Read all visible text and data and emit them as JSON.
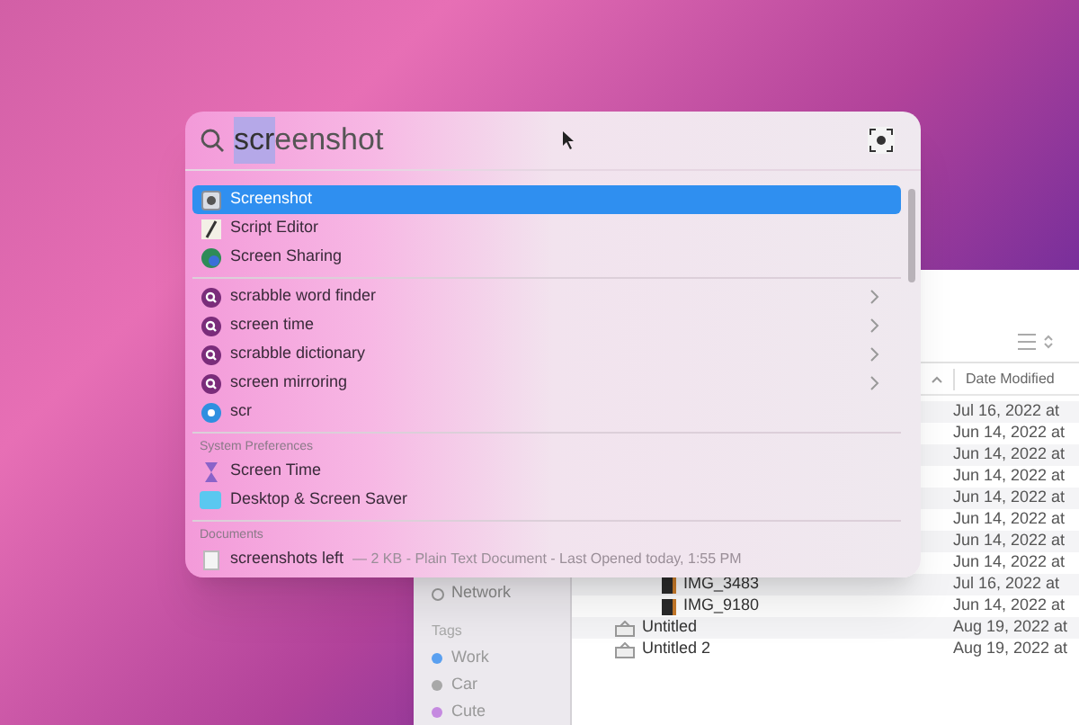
{
  "spotlight": {
    "query_typed": "scr",
    "query_completion": "eenshot",
    "sections": [
      {
        "items": [
          {
            "label": "Screenshot",
            "kind": "screenshot",
            "selected": true,
            "has_submenu": false
          },
          {
            "label": "Script Editor",
            "kind": "script",
            "selected": false,
            "has_submenu": false
          },
          {
            "label": "Screen Sharing",
            "kind": "sharing",
            "selected": false,
            "has_submenu": false
          }
        ]
      },
      {
        "items": [
          {
            "label": "scrabble word finder",
            "kind": "suggestion",
            "selected": false,
            "has_submenu": true
          },
          {
            "label": "screen time",
            "kind": "suggestion",
            "selected": false,
            "has_submenu": true
          },
          {
            "label": "scrabble dictionary",
            "kind": "suggestion",
            "selected": false,
            "has_submenu": true
          },
          {
            "label": "screen mirroring",
            "kind": "suggestion",
            "selected": false,
            "has_submenu": true
          },
          {
            "label": "scr",
            "kind": "web",
            "selected": false,
            "has_submenu": false
          }
        ]
      },
      {
        "header": "System Preferences",
        "items": [
          {
            "label": "Screen Time",
            "kind": "screentime",
            "selected": false,
            "has_submenu": false
          },
          {
            "label": "Desktop & Screen Saver",
            "kind": "desktop",
            "selected": false,
            "has_submenu": false
          }
        ]
      },
      {
        "header": "Documents",
        "items": [
          {
            "label": "screenshots left",
            "detail": "— 2 KB - Plain Text Document - Last Opened today, 1:55 PM",
            "kind": "document",
            "selected": false,
            "has_submenu": false
          }
        ]
      }
    ]
  },
  "finder": {
    "sidebar": {
      "items": [
        {
          "label": "Network",
          "kind": "location"
        }
      ],
      "tags_header": "Tags",
      "tags": [
        {
          "label": "Work",
          "color": "#5aa0f0"
        },
        {
          "label": "Car",
          "color": "#a8a8a8"
        },
        {
          "label": "Cute",
          "color": "#c58ae0"
        }
      ]
    },
    "column_header": "Date Modified",
    "rows": [
      {
        "date": "Jul 16, 2022 at"
      },
      {
        "date": "Jun 14, 2022 at"
      },
      {
        "date": "Jun 14, 2022 at"
      },
      {
        "date": "Jun 14, 2022 at"
      },
      {
        "date": "Jun 14, 2022 at"
      },
      {
        "date": "Jun 14, 2022 at"
      },
      {
        "date": "Jun 14, 2022 at"
      },
      {
        "date": "Jun 14, 2022 at"
      },
      {
        "name": "IMG_3483",
        "date": "Jul 16, 2022 at",
        "kind": "image"
      },
      {
        "name": "IMG_9180",
        "date": "Jun 14, 2022 at",
        "kind": "image"
      },
      {
        "name": "Untitled",
        "date": "Aug 19, 2022 at",
        "kind": "disk"
      },
      {
        "name": "Untitled 2",
        "date": "Aug 19, 2022 at",
        "kind": "disk"
      }
    ]
  }
}
